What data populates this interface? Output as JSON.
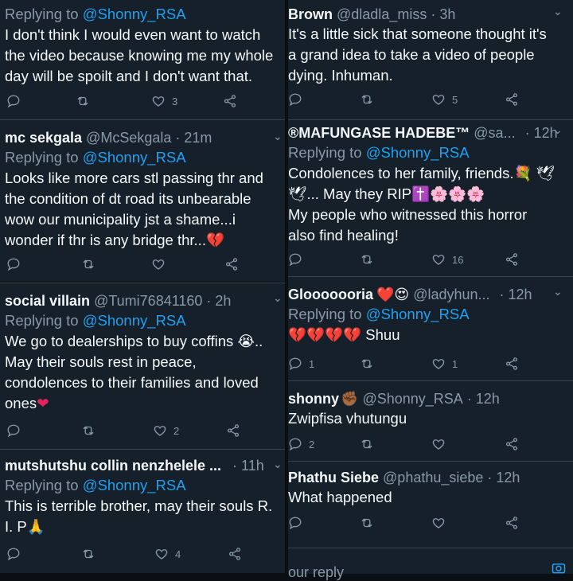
{
  "left": [
    {
      "reply_prefix": "Replying to ",
      "reply_to": "@Shonny_RSA",
      "body": "I don't think I would even want to watch\nthe video because knowing me my whole\nday will be spoilt and I don't want that.",
      "likes": "3"
    },
    {
      "name": "mc sekgala",
      "handle": "@McSekgala",
      "time": "· 21m",
      "reply_prefix": "Replying to ",
      "reply_to": "@Shonny_RSA",
      "body": "Looks like more cars stl passing thr and\nthe condition of dt road its unbearable\nwow our municipality jst a shame...i\nwonder if thr is any bridge thr...",
      "body_emoji": "💔",
      "likes": ""
    },
    {
      "name": "social villain",
      "handle": "@Tumi76841160",
      "time": "· 2h",
      "reply_prefix": "Replying to ",
      "reply_to": "@Shonny_RSA",
      "body": "We go to dealerships to buy coffins 😭..\nMay their souls rest in peace,\ncondolences to their families and loved\nones",
      "body_emoji": "❤",
      "likes": "2"
    },
    {
      "name": "mutshutshu collin nenzhelele ...",
      "time": "· 11h",
      "reply_prefix": "Replying to ",
      "reply_to": "@Shonny_RSA",
      "body": "This is terrible brother, may their souls R.\nI. P🙏",
      "likes": "4"
    }
  ],
  "right": [
    {
      "name": "Brown",
      "handle": "@dladla_miss",
      "time": "· 3h",
      "body": "It's a little sick that someone thought it's\na grand idea to take a video of people\ndying. Inhuman.",
      "likes": "5"
    },
    {
      "name": "®MAFUNGASE HADEBE™",
      "handle": "@sa...",
      "time": "· 12h",
      "reply_prefix": "Replying to ",
      "reply_to": "@Shonny_RSA",
      "body": "Condolences to her family, friends.💐 🕊\n🕊... May they RIP✝️🌸🌸🌸\nMy people who witnessed this horror\nalso find healing!",
      "likes": "16"
    },
    {
      "name": "Glooooooria",
      "name_emoji": "❤️😍",
      "handle": "@ladyhun...",
      "time": "· 12h",
      "reply_prefix": "Replying to ",
      "reply_to": "@Shonny_RSA",
      "body": "💔💔💔💔 Shuu",
      "replies": "1",
      "likes": "1"
    },
    {
      "name": "shonny",
      "name_emoji": "✊🏾",
      "handle": "@Shonny_RSA",
      "time": "· 12h",
      "body": "Zwipfisa vhutungu",
      "replies": "2",
      "likes": ""
    },
    {
      "name": "Phathu Siebe",
      "handle": "@phathu_siebe",
      "time": "· 12h",
      "body": "What happened",
      "likes": ""
    }
  ],
  "reply_bar": {
    "placeholder": "our reply"
  },
  "colors": {
    "background": "#15202b",
    "accent": "#1da1f2",
    "muted": "#8899a6",
    "text": "#f5f8fa",
    "separator": "#38444d"
  },
  "icons": {
    "reply": "comment-icon",
    "retweet": "retweet-icon",
    "like": "heart-icon",
    "share": "share-icon",
    "more": "chevron-down-icon"
  }
}
